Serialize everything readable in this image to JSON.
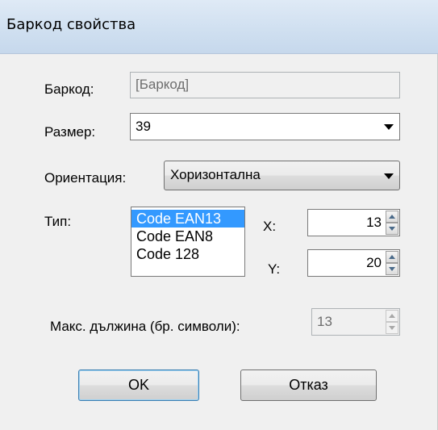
{
  "window": {
    "title": "Баркод свойства"
  },
  "barcode": {
    "label": "Баркод:",
    "value": "[Баркод]"
  },
  "size": {
    "label": "Размер:",
    "value": "39"
  },
  "orientation": {
    "label": "Ориентация:",
    "value": "Хоризонтална"
  },
  "type": {
    "label": "Тип:",
    "options": [
      "Code EAN13",
      "Code EAN8",
      "Code 128"
    ],
    "selected": "Code EAN13"
  },
  "position": {
    "x_label": "X:",
    "x_value": "13",
    "y_label": "Y:",
    "y_value": "20"
  },
  "max_length": {
    "label": "Макс. дължина (бр. символи):",
    "value": "13"
  },
  "buttons": {
    "ok": "OK",
    "cancel": "Отказ"
  }
}
